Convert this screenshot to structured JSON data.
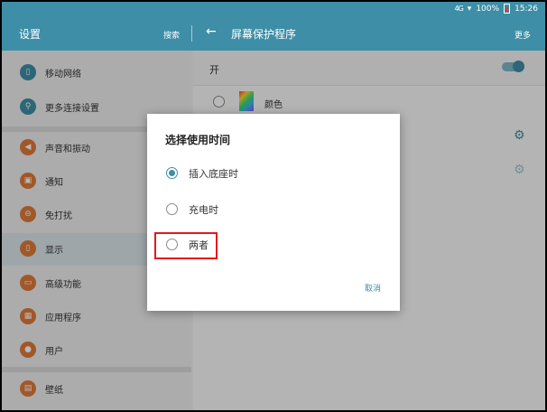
{
  "status": {
    "signal": "4G",
    "battery": "100%",
    "time": "15:26"
  },
  "appbar": {
    "left_title": "设置",
    "search": "搜索",
    "back": "←",
    "right_title": "屏幕保护程序",
    "more": "更多"
  },
  "sidebar": {
    "items": [
      {
        "label": "移动网络",
        "icon": "mobile-network-icon",
        "color": "#3d8ea6",
        "glyph": "▯"
      },
      {
        "label": "更多连接设置",
        "icon": "connection-icon",
        "color": "#3d8ea6",
        "glyph": "⚲"
      },
      {
        "label": "声音和振动",
        "icon": "sound-icon",
        "color": "#e07a3a",
        "glyph": "◀"
      },
      {
        "label": "通知",
        "icon": "notification-icon",
        "color": "#e07a3a",
        "glyph": "▣"
      },
      {
        "label": "免打扰",
        "icon": "do-not-disturb-icon",
        "color": "#e07a3a",
        "glyph": "⊖"
      },
      {
        "label": "显示",
        "icon": "display-icon",
        "color": "#e07a3a",
        "glyph": "▯"
      },
      {
        "label": "高级功能",
        "icon": "advanced-features-icon",
        "color": "#e07a3a",
        "glyph": "▭"
      },
      {
        "label": "应用程序",
        "icon": "apps-icon",
        "color": "#e07a3a",
        "glyph": "▦"
      },
      {
        "label": "用户",
        "icon": "user-icon",
        "color": "#e07a3a",
        "glyph": "●"
      },
      {
        "label": "壁纸",
        "icon": "wallpaper-icon",
        "color": "#e07a3a",
        "glyph": "▤"
      }
    ]
  },
  "main": {
    "on_label": "开",
    "color_label": "颜色"
  },
  "dialog": {
    "title": "选择使用时间",
    "options": [
      {
        "label": "插入底座时",
        "checked": true
      },
      {
        "label": "充电时",
        "checked": false
      },
      {
        "label": "两者",
        "checked": false
      }
    ],
    "cancel": "取消"
  },
  "colors": {
    "accent": "#3d8ea6",
    "highlight": "#e01a1a"
  }
}
